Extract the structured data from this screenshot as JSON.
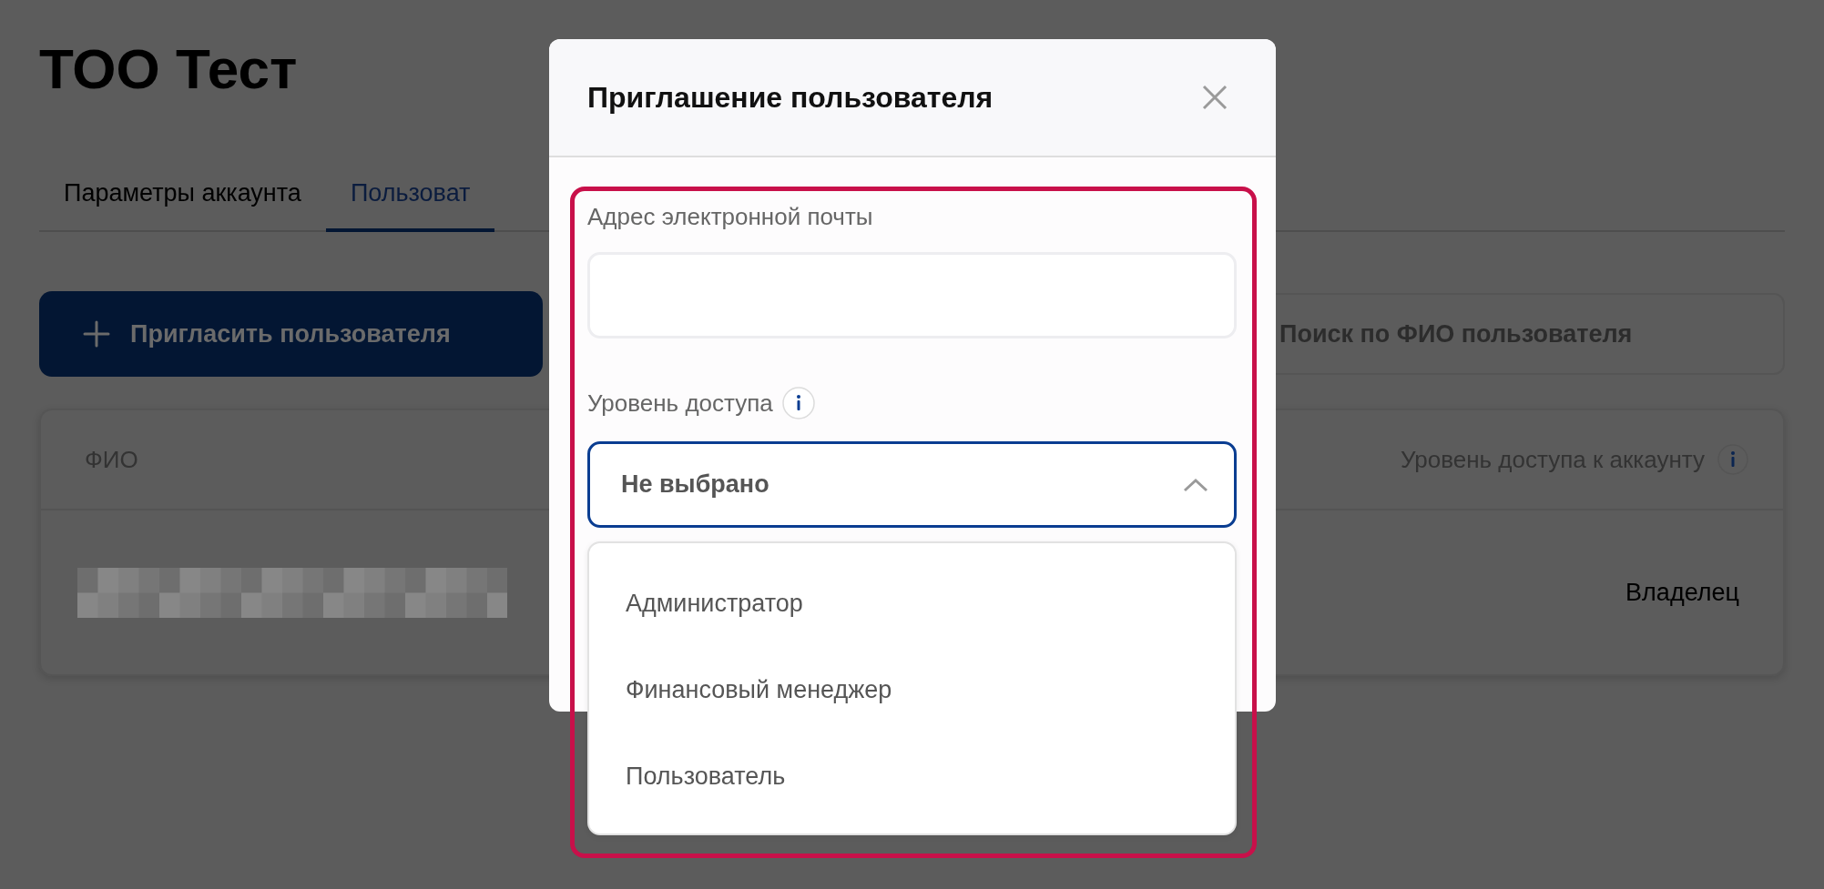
{
  "page": {
    "title": "ТОО Тест"
  },
  "tabs": [
    {
      "label": "Параметры аккаунта",
      "selected": false
    },
    {
      "label": "Пользоват",
      "selected": true
    }
  ],
  "invite_button": {
    "label": "Пригласить пользователя"
  },
  "search": {
    "placeholder": "Поиск по ФИО пользователя"
  },
  "table": {
    "columns": [
      "ФИО",
      "Уровень доступа к аккаунту"
    ],
    "rows": [
      {
        "access": "Владелец"
      }
    ]
  },
  "modal": {
    "title": "Приглашение пользователя",
    "email": {
      "label": "Адрес электронной почты"
    },
    "access": {
      "label": "Уровень доступа",
      "value": "Не выбрано",
      "expanded": true,
      "options": [
        {
          "label": "Администратор",
          "selected": false
        },
        {
          "label": "Финансовый менеджер",
          "selected": false
        },
        {
          "label": "Пользователь",
          "selected": false
        }
      ]
    }
  }
}
